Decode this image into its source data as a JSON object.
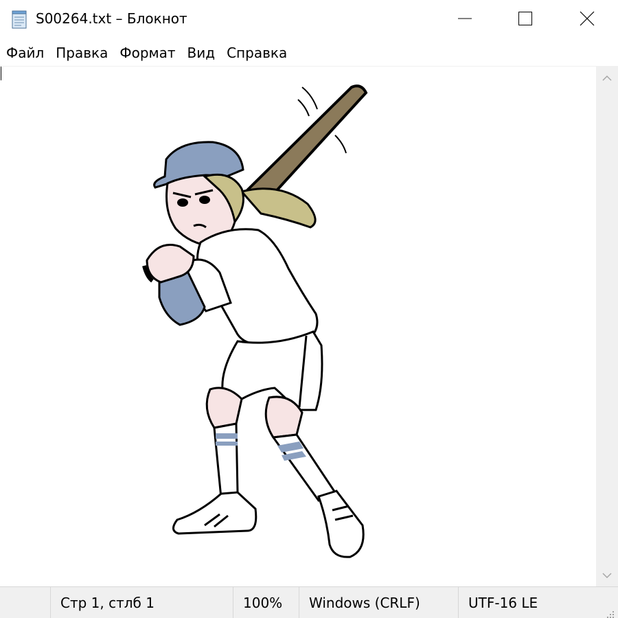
{
  "window": {
    "title": "S00264.txt – Блокнот"
  },
  "menu": {
    "items": [
      "Файл",
      "Правка",
      "Формат",
      "Вид",
      "Справка"
    ]
  },
  "status": {
    "position": "Стр 1, стлб 1",
    "zoom": "100%",
    "line_endings": "Windows (CRLF)",
    "encoding": "UTF-16 LE"
  },
  "colors": {
    "cap": "#8a9fbf",
    "hair": "#c8c08a",
    "bat": "#8b7a5a",
    "skin": "#f7e4e4",
    "sleeve": "#8a9fbf",
    "sock_stripe": "#8a9fbf",
    "outline": "#000000"
  },
  "icons": {
    "app": "notepad-icon",
    "minimize": "minimize-icon",
    "maximize": "maximize-icon",
    "close": "close-icon",
    "scroll_up": "chevron-up-icon",
    "scroll_down": "chevron-down-icon",
    "grip": "resize-grip-icon"
  }
}
